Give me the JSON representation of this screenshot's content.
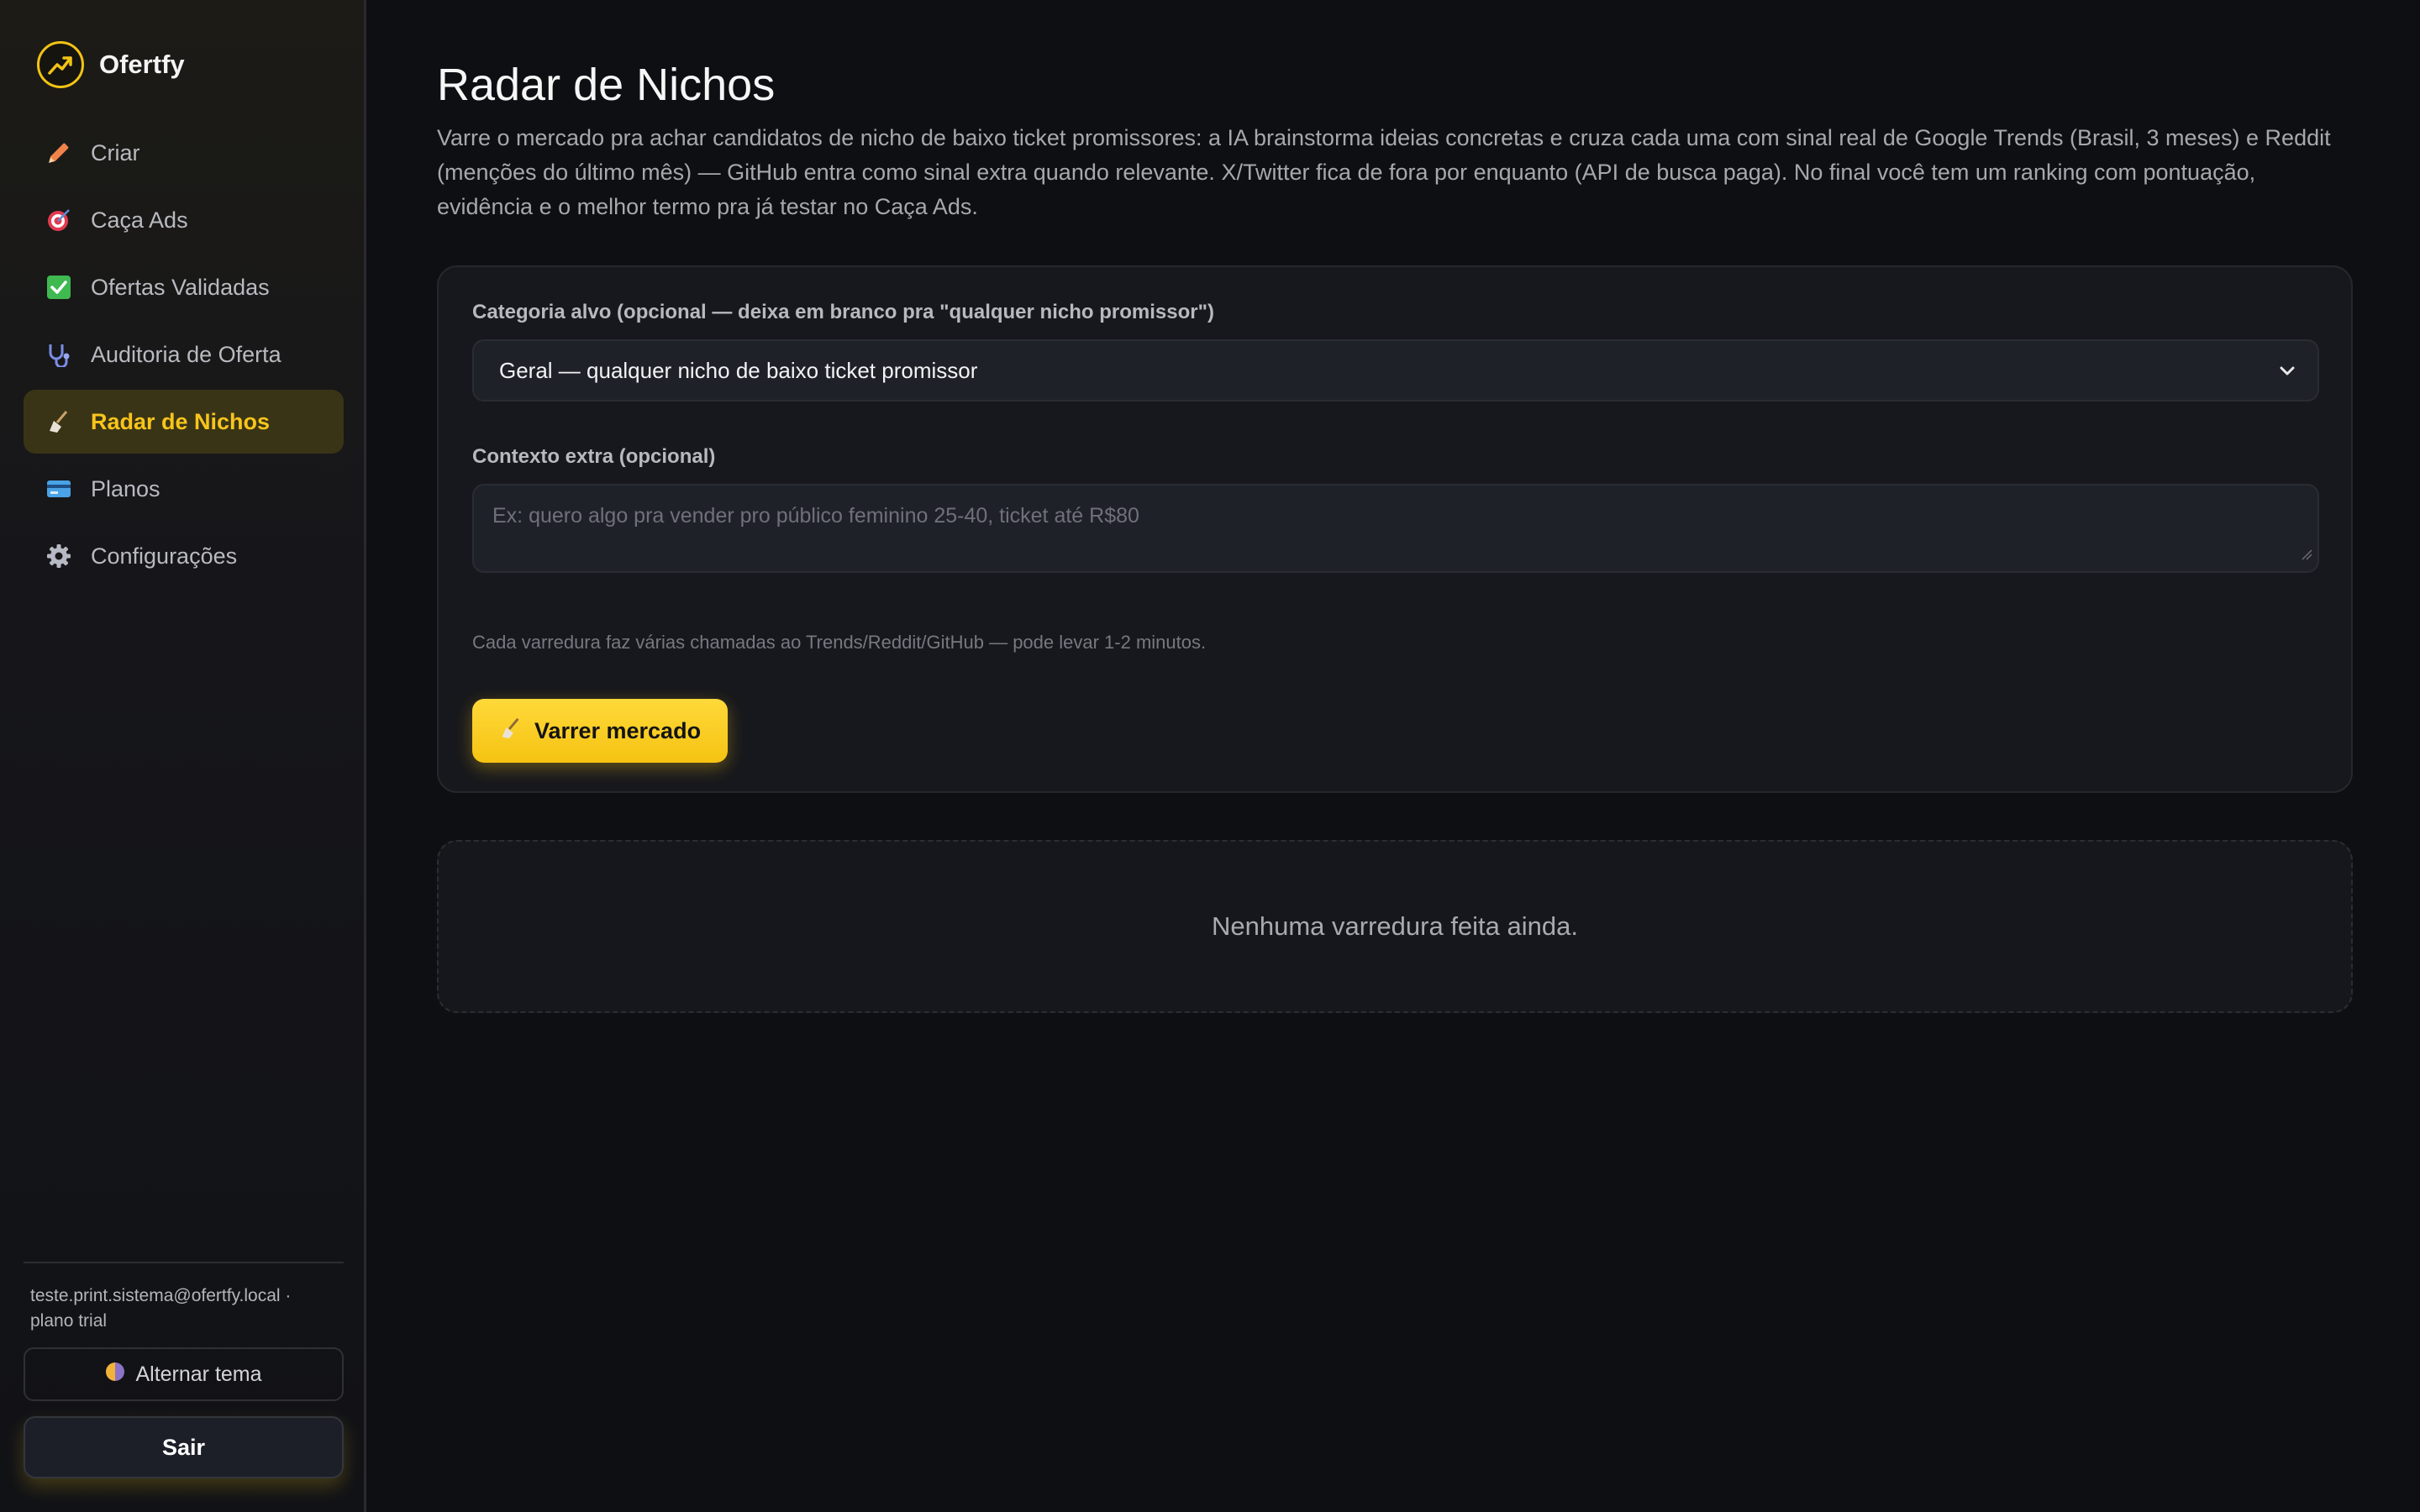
{
  "brand": {
    "name": "Ofertfy",
    "icon": "trend-up-icon",
    "accent": "#f2c315"
  },
  "sidebar": {
    "items": [
      {
        "label": "Criar",
        "icon": "pencil-icon",
        "active": false
      },
      {
        "label": "Caça Ads",
        "icon": "target-icon",
        "active": false
      },
      {
        "label": "Ofertas Validadas",
        "icon": "check-box-icon",
        "active": false
      },
      {
        "label": "Auditoria de Oferta",
        "icon": "stethoscope-icon",
        "active": false
      },
      {
        "label": "Radar de Nichos",
        "icon": "broom-icon",
        "active": true
      },
      {
        "label": "Planos",
        "icon": "credit-card-icon",
        "active": false
      },
      {
        "label": "Configurações",
        "icon": "gear-icon",
        "active": false
      }
    ],
    "user_email": "teste.print.sistema@ofertfy.local ·",
    "user_plan": "plano trial",
    "theme_toggle_label": "Alternar tema",
    "logout_label": "Sair"
  },
  "main": {
    "title": "Radar de Nichos",
    "description": "Varre o mercado pra achar candidatos de nicho de baixo ticket promissores: a IA brainstorma ideias concretas e cruza cada uma com sinal real de Google Trends (Brasil, 3 meses) e Reddit (menções do último mês) — GitHub entra como sinal extra quando relevante. X/Twitter fica de fora por enquanto (API de busca paga). No final você tem um ranking com pontuação, evidência e o melhor termo pra já testar no Caça Ads.",
    "form": {
      "category_label": "Categoria alvo (opcional — deixa em branco pra \"qualquer nicho promissor\")",
      "category_value": "Geral — qualquer nicho de baixo ticket promissor",
      "context_label": "Contexto extra (opcional)",
      "context_placeholder": "Ex: quero algo pra vender pro público feminino 25-40, ticket até R$80",
      "hint": "Cada varredura faz várias chamadas ao Trends/Reddit/GitHub — pode levar 1-2 minutos.",
      "scan_button": "Varrer mercado"
    },
    "empty_state": "Nenhuma varredura feita ainda."
  }
}
